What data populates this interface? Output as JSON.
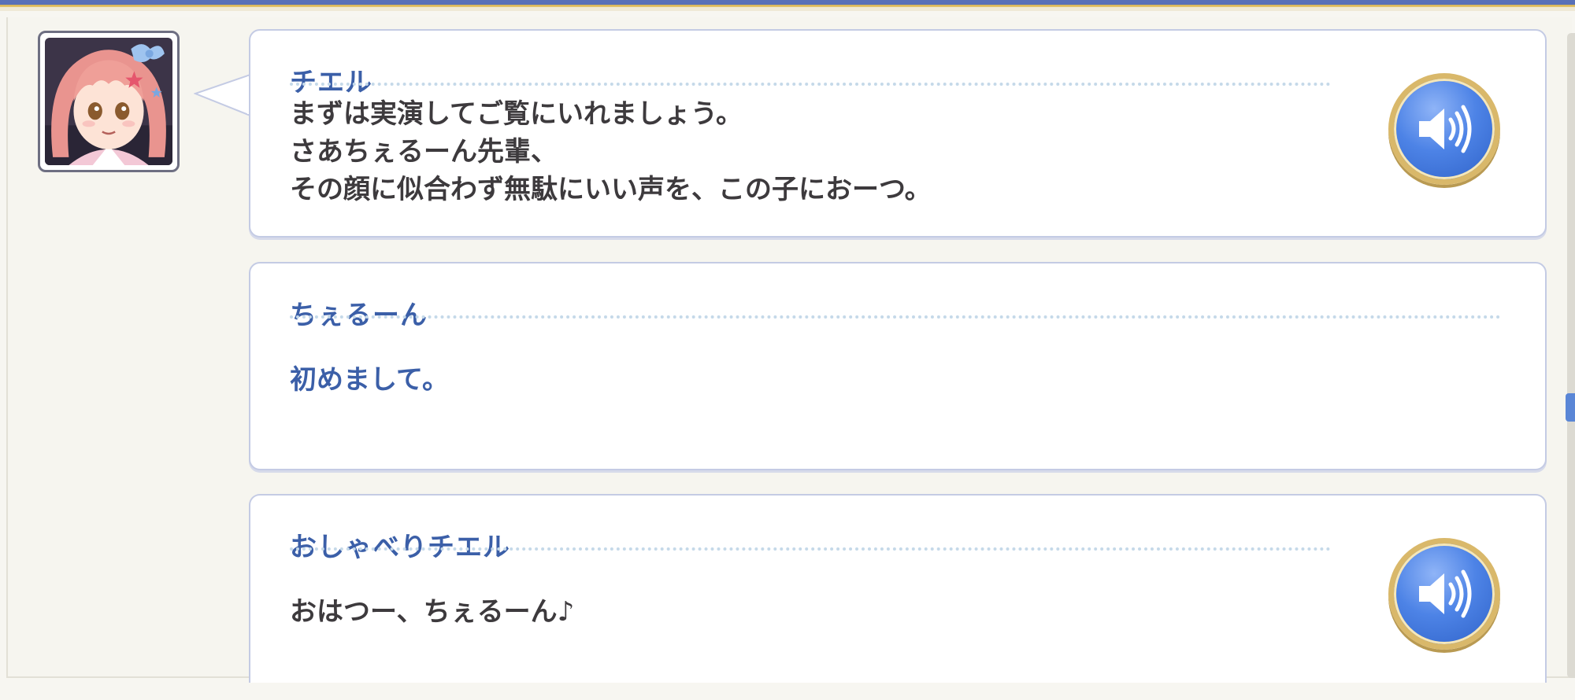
{
  "messages": [
    {
      "speaker": "チエル",
      "text": "まずは実演してご覧にいれましょう。\nさあちぇるーん先輩、\nその顔に似合わず無駄にいい声を、この子におーつ。",
      "has_voice": true,
      "has_avatar": true
    },
    {
      "speaker": "ちぇるーん",
      "text": "初めまして。",
      "has_voice": false,
      "has_avatar": false
    },
    {
      "speaker": "おしゃべりチエル",
      "text": "おはつー、ちぇるーん♪",
      "has_voice": true,
      "has_avatar": false
    }
  ],
  "icons": {
    "voice": "speaker-volume-icon",
    "avatar": "character-portrait"
  },
  "colors": {
    "speaker_name": "#3b5fa8",
    "dialogue_text": "#3d3a3d",
    "voice_button": "#4d83e6",
    "voice_button_rim": "#d9b86a",
    "scroll_thumb": "#5a86d6"
  }
}
